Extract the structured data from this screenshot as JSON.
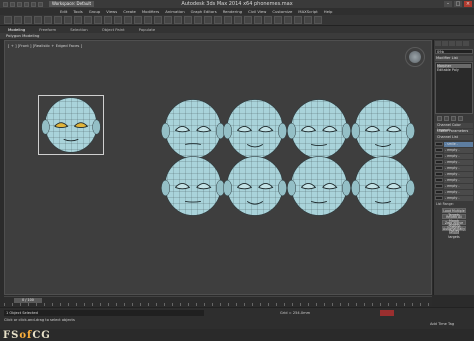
{
  "titlebar": {
    "workspace": "Workspace: Default",
    "app_title": "Autodesk 3ds Max  2014 x64      phonemes.max"
  },
  "menu": [
    "Edit",
    "Tools",
    "Group",
    "Views",
    "Create",
    "Modifiers",
    "Animation",
    "Graph Editors",
    "Rendering",
    "Civil View",
    "Customize",
    "MAXScript",
    "Help"
  ],
  "ribbon": {
    "tabs": [
      "Modeling",
      "Freeform",
      "Selection",
      "Object Paint",
      "Populate"
    ],
    "active": "Modeling",
    "sub": "Polygon Modeling"
  },
  "viewport": {
    "label": "[ + ] [Front ] [Realistic + Edged Faces ]"
  },
  "command_panel": {
    "object_name": "09b",
    "modifier_list": "Modifier List",
    "stack": [
      "Morpher",
      "Editable Poly"
    ],
    "rollouts": {
      "channel_color": "Channel Color Legend",
      "global_params": "Global Parameters",
      "channel_list": "Channel List"
    },
    "channels": [
      {
        "label": "- smile -",
        "active": true
      },
      {
        "label": "- empty -",
        "active": false
      },
      {
        "label": "- empty -",
        "active": false
      },
      {
        "label": "- empty -",
        "active": false
      },
      {
        "label": "- empty -",
        "active": false
      },
      {
        "label": "- empty -",
        "active": false
      },
      {
        "label": "- empty -",
        "active": false
      },
      {
        "label": "- empty -",
        "active": false
      },
      {
        "label": "- empty -",
        "active": false
      },
      {
        "label": "- empty -",
        "active": false
      }
    ],
    "list_range": "List Range:",
    "buttons": [
      "Load Multiple Targets",
      "Reload All Morph Targets",
      "Zero Active Channel Values",
      "Automatically reload targets"
    ]
  },
  "timeline": {
    "slider": "0 / 100"
  },
  "status": {
    "selected": "1 Object Selected",
    "hint": "Click or click-and-drag to select objects",
    "grid": "Grid = 254.0mm",
    "add_tag": "Add Time Tag"
  },
  "watermark": {
    "text_left": "FS",
    "text_mid": "of",
    "text_right": "CG"
  },
  "colors": {
    "mesh": "#a9d3da",
    "selection_highlight": "#e0b43a",
    "autokey": "#9a2f2f"
  }
}
